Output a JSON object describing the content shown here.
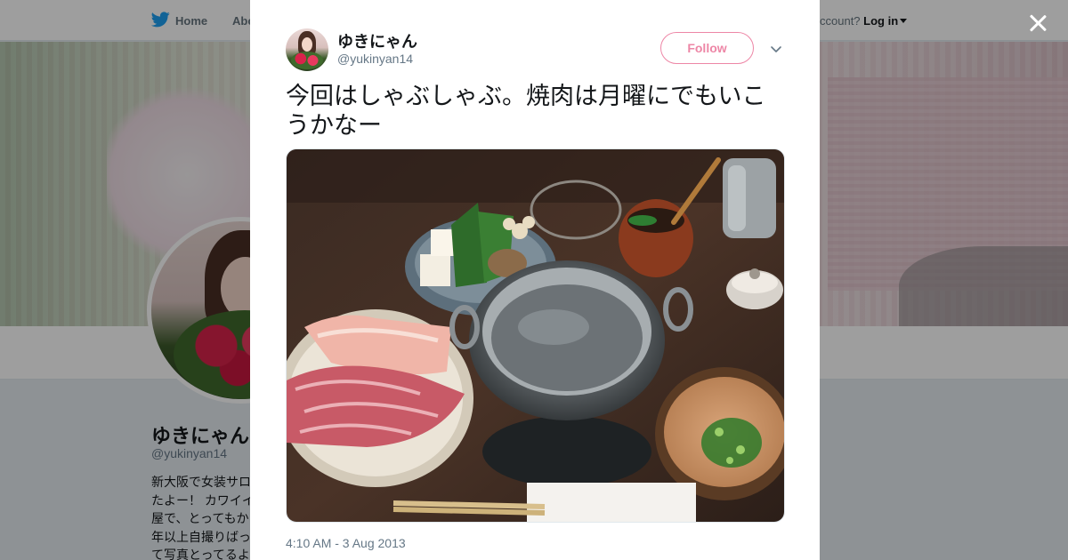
{
  "nav": {
    "home_label": "Home",
    "about_label": "Abo",
    "login_prefix": "ccount?",
    "login_label": "Log in"
  },
  "profile": {
    "name": "ゆきにゃん",
    "handle": "@yukinyan14",
    "bio_lines": [
      "新大阪で女装サロ",
      "たよー！ カワイイ",
      "屋で、とってもか",
      "年以上自撮りばっ",
      "て写真とってるよ"
    ]
  },
  "tweet": {
    "author_name": "ゆきにゃん",
    "author_handle": "@yukinyan14",
    "follow_label": "Follow",
    "text": "今回はしゃぶしゃぶ。焼肉は月曜にでもいこうかなー",
    "timestamp": "4:10 AM - 3 Aug 2013"
  },
  "colors": {
    "follow_accent": "#e0245e",
    "twitter_blue": "#1da1f2",
    "secondary_text": "#657786"
  },
  "icons": {
    "nav_home": "twitter-bird-icon",
    "close": "close-icon",
    "more": "chevron-down-icon"
  }
}
